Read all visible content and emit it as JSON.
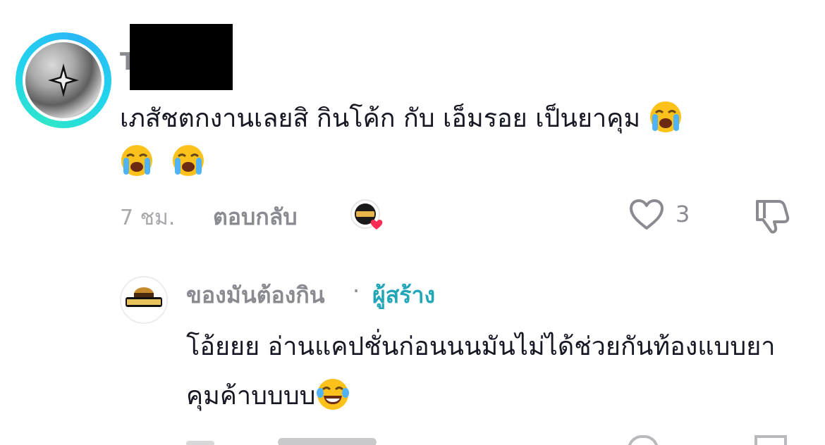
{
  "comment": {
    "username_initial": "T",
    "text": "เภสัชตกงานเลยสิ กินโค้ก กับ เอ็มรอย เป็นยาคุม",
    "emojis": [
      "loudly-crying-face",
      "loudly-crying-face",
      "loudly-crying-face"
    ],
    "time": "7 ชม.",
    "reply_label": "ตอบกลับ",
    "like_count": "3",
    "creator_liked": true
  },
  "reply": {
    "username": "ของมันต้องกิน",
    "separator": "·",
    "creator_badge": "ผู้สร้าง",
    "text": "โอ้ยยย อ่านแคปชั่นก่อนนนมันไม่ได้ช่วยกันท้องแบบยาคุมค้าบบบบ",
    "emoji": "face-with-tears-of-joy"
  },
  "colors": {
    "avatar_ring": "#22d3ee",
    "creator_badge": "#22a6b8",
    "heart": "#fe2c55",
    "muted_text": "#8a8b91"
  }
}
